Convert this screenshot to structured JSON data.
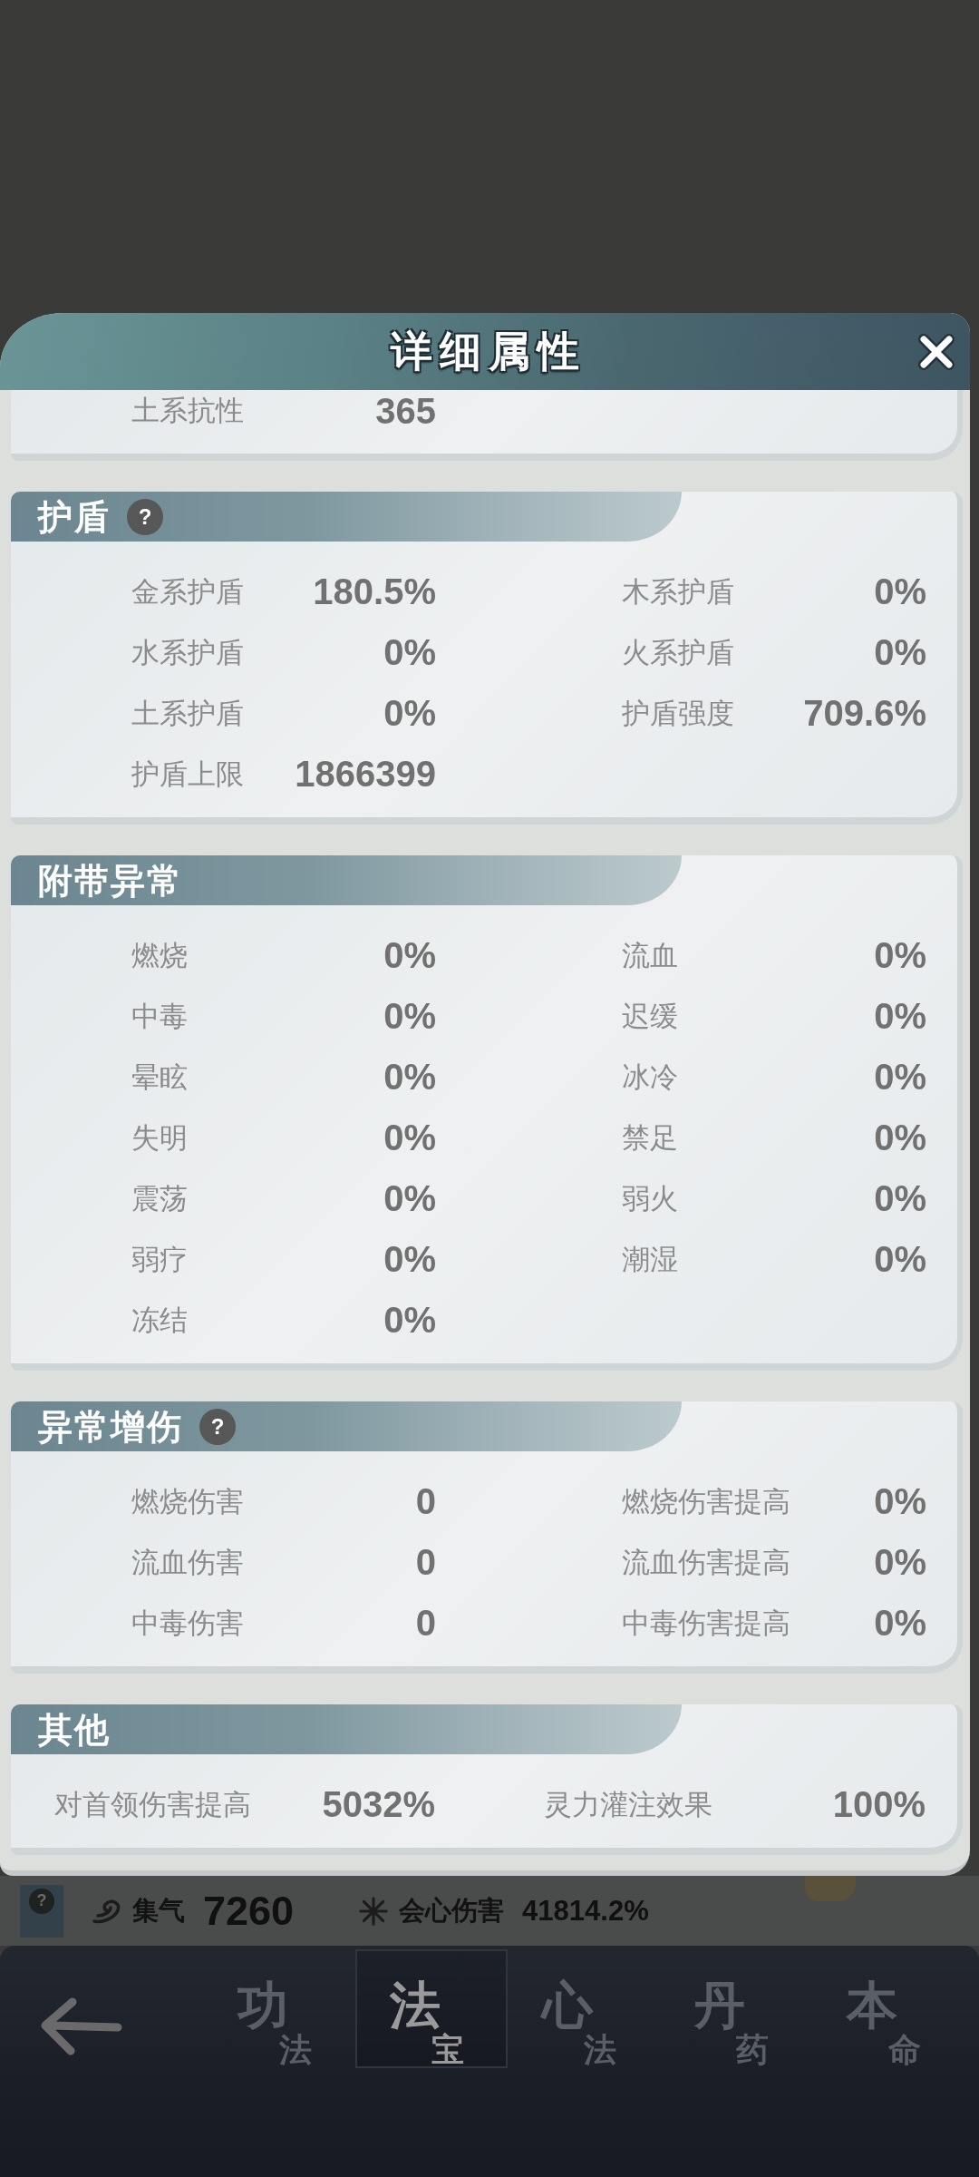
{
  "dialog": {
    "title": "详细属性"
  },
  "sections": [
    {
      "kind": "cut",
      "rows": [
        {
          "label": "土系抗性",
          "value": "365"
        }
      ]
    },
    {
      "kind": "grid",
      "title": "护盾",
      "help": "?",
      "rows": [
        {
          "label": "金系护盾",
          "value": "180.5%"
        },
        {
          "label": "木系护盾",
          "value": "0%"
        },
        {
          "label": "水系护盾",
          "value": "0%"
        },
        {
          "label": "火系护盾",
          "value": "0%"
        },
        {
          "label": "土系护盾",
          "value": "0%"
        },
        {
          "label": "护盾强度",
          "value": "709.6%"
        },
        {
          "label": "护盾上限",
          "value": "1866399"
        }
      ]
    },
    {
      "kind": "grid",
      "title": "附带异常",
      "rows": [
        {
          "label": "燃烧",
          "value": "0%"
        },
        {
          "label": "流血",
          "value": "0%"
        },
        {
          "label": "中毒",
          "value": "0%"
        },
        {
          "label": "迟缓",
          "value": "0%"
        },
        {
          "label": "晕眩",
          "value": "0%"
        },
        {
          "label": "冰冷",
          "value": "0%"
        },
        {
          "label": "失明",
          "value": "0%"
        },
        {
          "label": "禁足",
          "value": "0%"
        },
        {
          "label": "震荡",
          "value": "0%"
        },
        {
          "label": "弱火",
          "value": "0%"
        },
        {
          "label": "弱疗",
          "value": "0%"
        },
        {
          "label": "潮湿",
          "value": "0%"
        },
        {
          "label": "冻结",
          "value": "0%"
        }
      ]
    },
    {
      "kind": "grid",
      "title": "异常增伤",
      "help": "?",
      "rows": [
        {
          "label": "燃烧伤害",
          "value": "0"
        },
        {
          "label": "燃烧伤害提高",
          "value": "0%"
        },
        {
          "label": "流血伤害",
          "value": "0"
        },
        {
          "label": "流血伤害提高",
          "value": "0%"
        },
        {
          "label": "中毒伤害",
          "value": "0"
        },
        {
          "label": "中毒伤害提高",
          "value": "0%"
        }
      ]
    },
    {
      "kind": "wide",
      "title": "其他",
      "rows": [
        {
          "label": "对首领伤害提高",
          "value": "5032%"
        },
        {
          "label": "灵力灌注效果",
          "value": "100%"
        }
      ]
    }
  ],
  "status_strip": {
    "help": "?",
    "stats": [
      {
        "kind": "swirl",
        "label": "集气",
        "value": "7260"
      },
      {
        "kind": "burst",
        "label": "会心伤害",
        "value": "41814.2%"
      }
    ]
  },
  "nav": {
    "tabs": [
      {
        "main": "功",
        "sub": "法",
        "selected": false
      },
      {
        "main": "法",
        "sub": "宝",
        "selected": true
      },
      {
        "main": "心",
        "sub": "法",
        "selected": false
      },
      {
        "main": "丹",
        "sub": "药",
        "selected": false
      },
      {
        "main": "本",
        "sub": "命",
        "selected": false
      }
    ]
  }
}
